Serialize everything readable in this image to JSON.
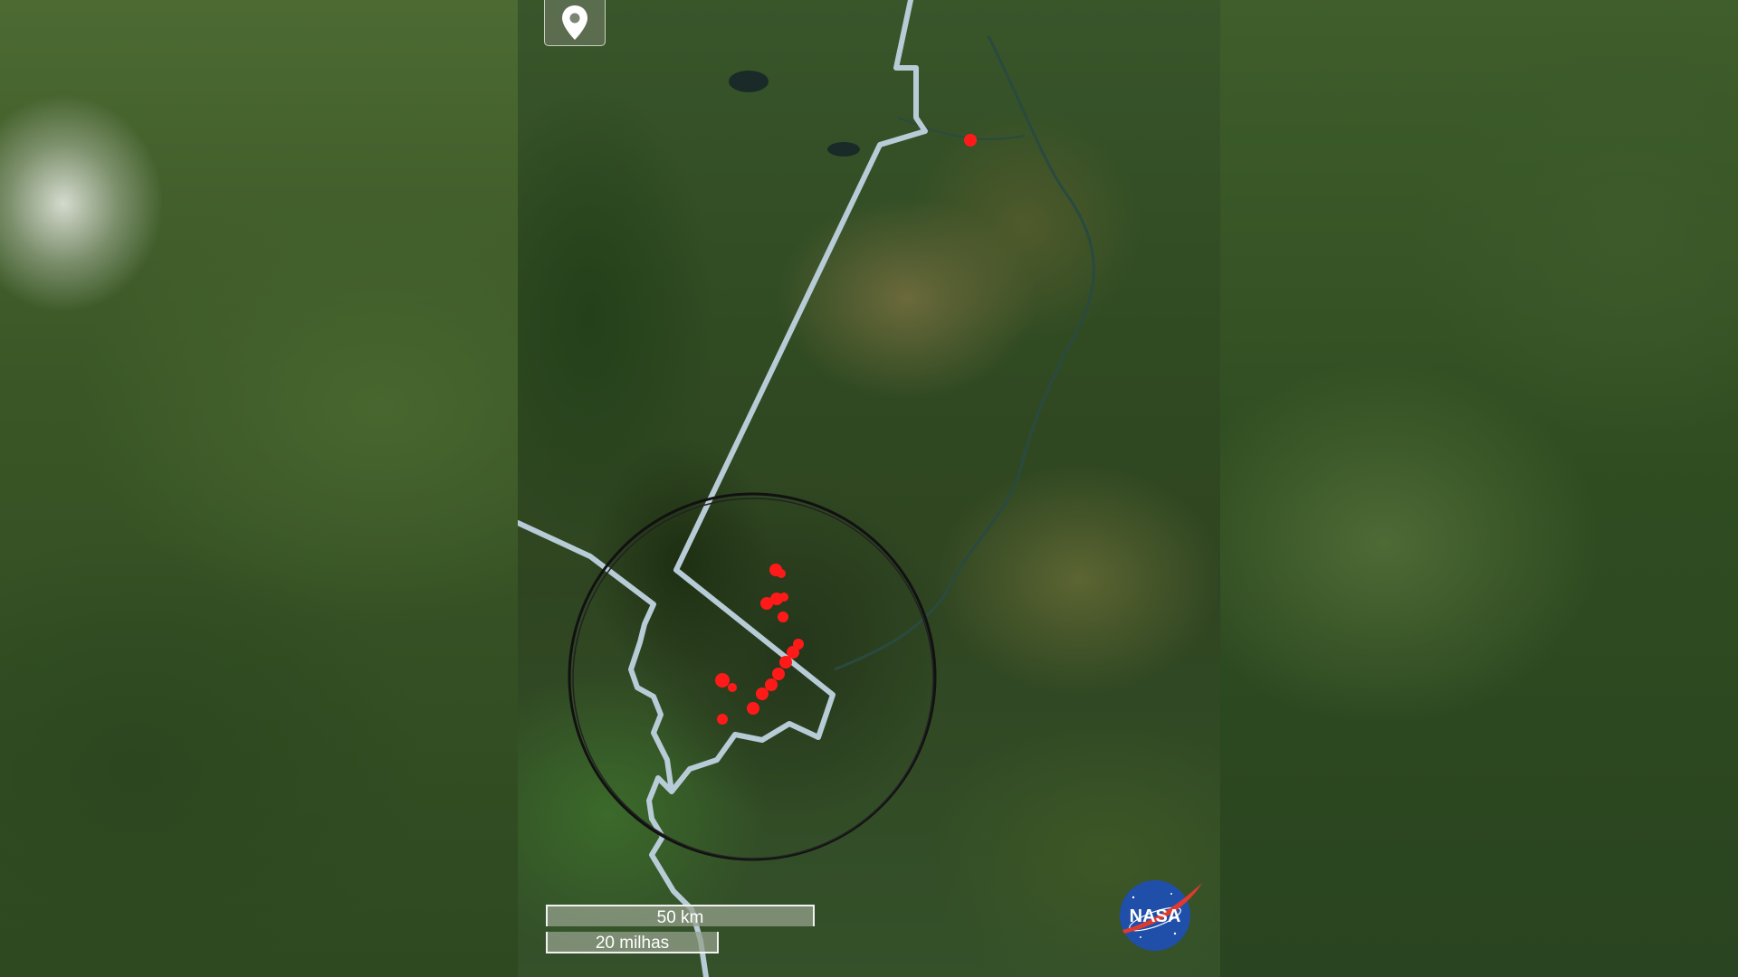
{
  "map": {
    "scale": {
      "metric_label": "50 km",
      "imperial_label": "20 milhas"
    },
    "logo": {
      "text": "NASA",
      "color_blue": "#1f4fa8",
      "color_red": "#e03a2e"
    },
    "markers": {
      "fire_color": "#ff1a1a",
      "border_color": "#b8ccd8"
    },
    "icons": {
      "location_pin": "map-pin-icon"
    }
  }
}
